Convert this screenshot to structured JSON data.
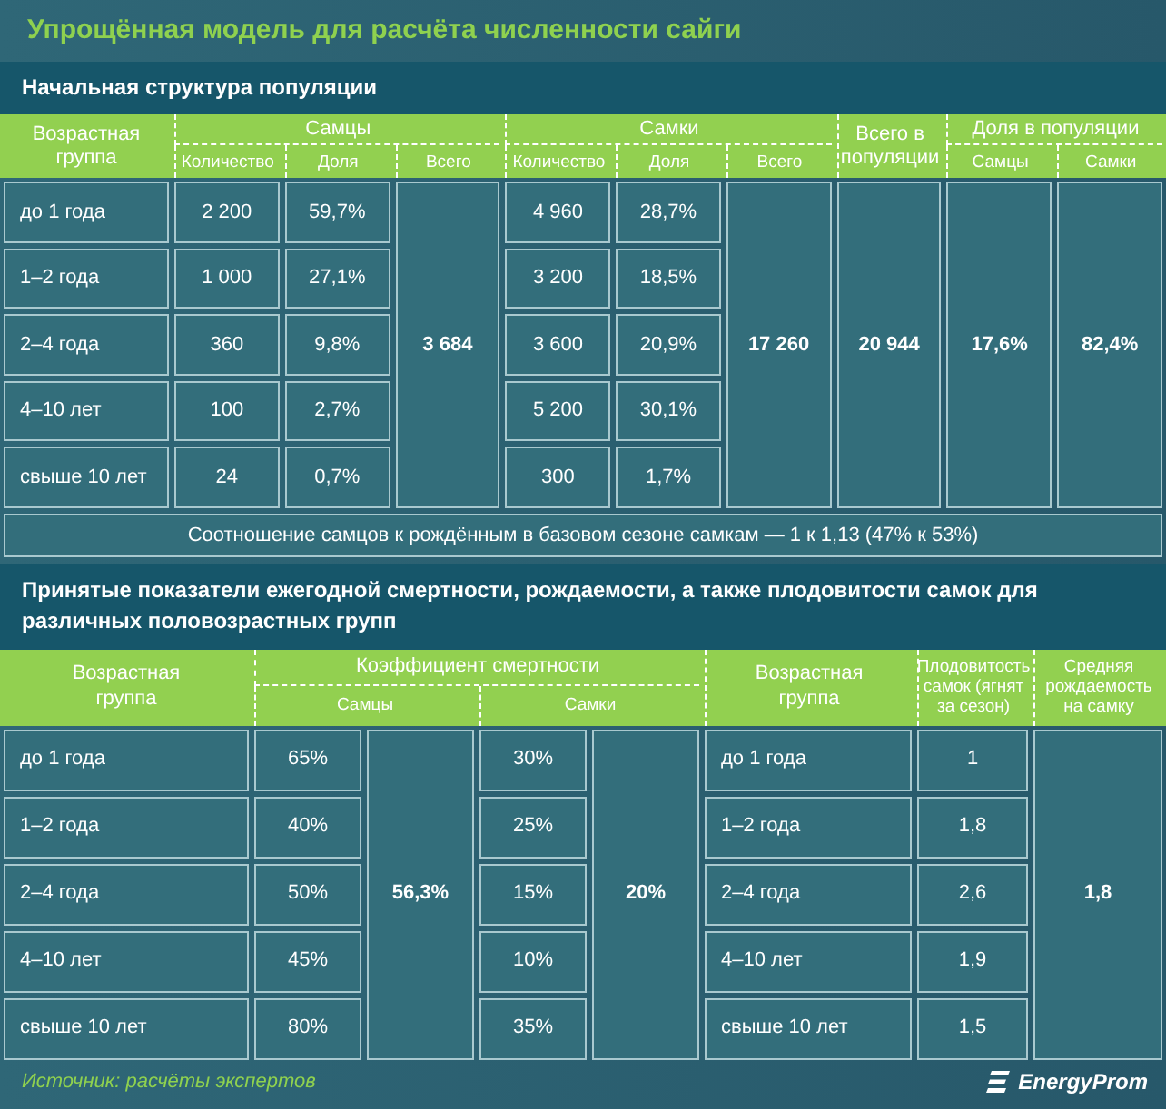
{
  "title": "Упрощённая модель для расчёта численности сайги",
  "section_1": {
    "heading": "Начальная структура популяции",
    "header": {
      "age_group": "Возрастная группа",
      "males": "Самцы",
      "females": "Самки",
      "population_total": "Всего в популяции",
      "population_share": "Доля в популяции",
      "subheaders": [
        "Количество",
        "Доля",
        "Всего",
        "Количество",
        "Доля",
        "Всего",
        "Самцы",
        "Самки"
      ]
    },
    "rows": [
      {
        "age": "до 1 года",
        "males_count": "2 200",
        "males_share": "59,7%",
        "females_count": "4 960",
        "females_share": "28,7%"
      },
      {
        "age": "1–2 года",
        "males_count": "1 000",
        "males_share": "27,1%",
        "females_count": "3 200",
        "females_share": "18,5%"
      },
      {
        "age": "2–4 года",
        "males_count": "360",
        "males_share": "9,8%",
        "females_count": "3 600",
        "females_share": "20,9%"
      },
      {
        "age": "4–10 лет",
        "males_count": "100",
        "males_share": "2,7%",
        "females_count": "5 200",
        "females_share": "30,1%"
      },
      {
        "age": "свыше 10 лет",
        "males_count": "24",
        "males_share": "0,7%",
        "females_count": "300",
        "females_share": "1,7%"
      }
    ],
    "males_total": "3 684",
    "females_total": "17 260",
    "population_total": "20 944",
    "share_males": "17,6%",
    "share_females": "82,4%",
    "ratio_note": "Соотношение самцов к рождённым в базовом сезоне самкам — 1 к 1,13 (47% к 53%)"
  },
  "section_2": {
    "heading": "Принятые показатели ежегодной смертности, рождаемости, а также плодовитости самок для различных половозрастных групп",
    "header": {
      "age_group": "Возрастная группа",
      "mortality": "Коэффициент смертности",
      "males": "Самцы",
      "females": "Самки",
      "age_group_2": "Возрастная группа",
      "fertility": "Плодовитость самок (ягнят за сезон)",
      "average_birth_rate": "Средняя рождаемость на самку"
    },
    "rows": [
      {
        "age": "до 1 года",
        "male_mortality": "65%",
        "female_mortality": "30%",
        "age_2": "до 1 года",
        "fertility": "1"
      },
      {
        "age": "1–2 года",
        "male_mortality": "40%",
        "female_mortality": "25%",
        "age_2": "1–2 года",
        "fertility": "1,8"
      },
      {
        "age": "2–4 года",
        "male_mortality": "50%",
        "female_mortality": "15%",
        "age_2": "2–4 года",
        "fertility": "2,6"
      },
      {
        "age": "4–10 лет",
        "male_mortality": "45%",
        "female_mortality": "10%",
        "age_2": "4–10 лет",
        "fertility": "1,9"
      },
      {
        "age": "свыше 10 лет",
        "male_mortality": "80%",
        "female_mortality": "35%",
        "age_2": "свыше 10 лет",
        "fertility": "1,5"
      }
    ],
    "male_mortality_total": "56,3%",
    "female_mortality_total": "20%",
    "average_birth_rate": "1,8"
  },
  "source": "Источник: расчёты экспертов",
  "logo": "EnergyProm"
}
